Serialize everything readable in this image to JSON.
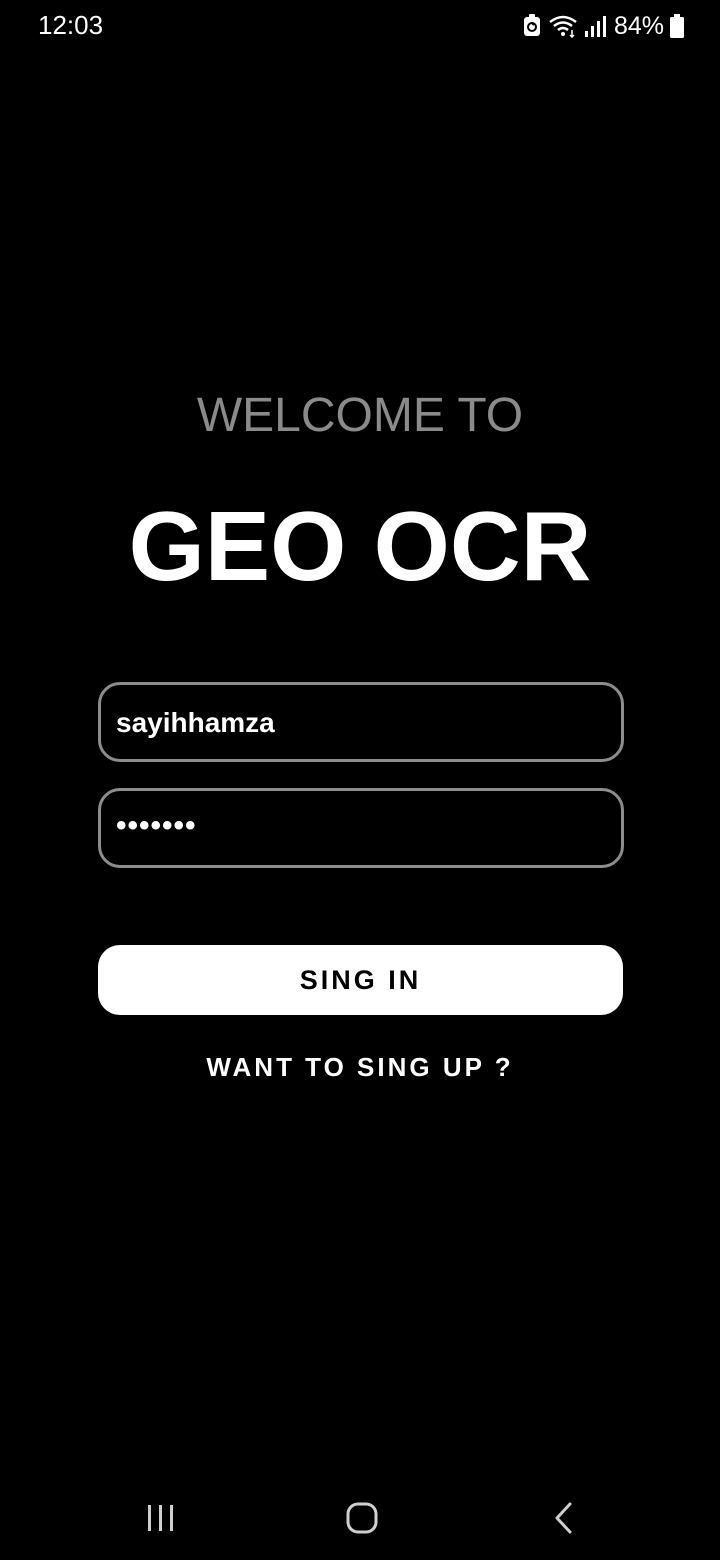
{
  "status_bar": {
    "time": "12:03",
    "battery_percent": "84%",
    "icons": [
      "data-saver-icon",
      "wifi-icon",
      "signal-icon",
      "battery-icon"
    ]
  },
  "welcome": {
    "subtitle": "WELCOME TO",
    "title": "GEO OCR"
  },
  "form": {
    "username_value": "sayihhamza",
    "password_value": "•••••••",
    "signin_label": "SING IN",
    "signup_link": "WANT TO SING UP ?"
  },
  "nav": {
    "icons": [
      "recent-apps-icon",
      "home-icon",
      "back-icon"
    ]
  },
  "colors": {
    "background": "#000000",
    "subtitle": "#8a8a8a",
    "field_border": "#8c8c8c",
    "button_bg": "#ffffff",
    "button_text": "#000000"
  }
}
